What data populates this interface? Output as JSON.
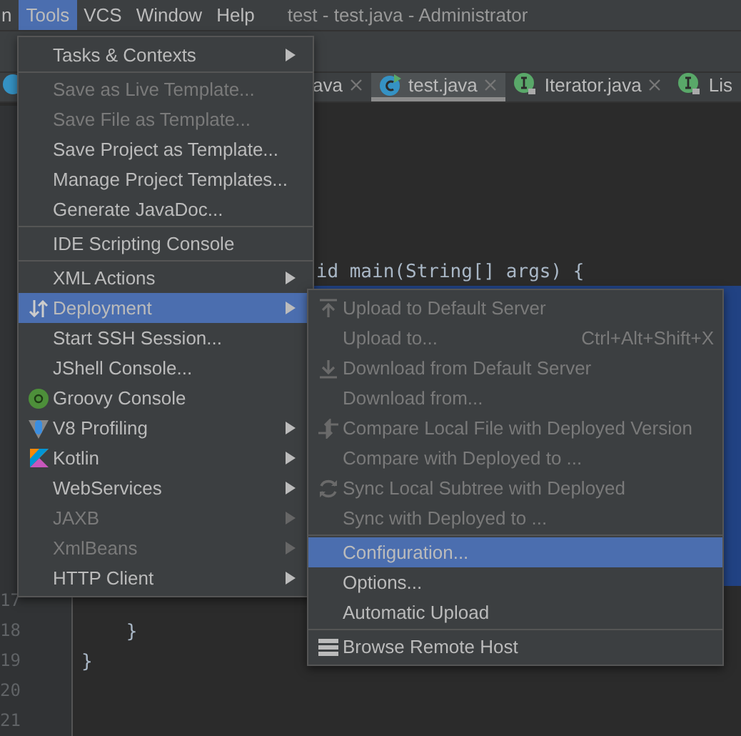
{
  "menubar": [
    {
      "label": "n",
      "selected": false
    },
    {
      "label": "Tools",
      "selected": true
    },
    {
      "label": "VCS",
      "selected": false
    },
    {
      "label": "Window",
      "selected": false
    },
    {
      "label": "Help",
      "selected": false
    }
  ],
  "window": {
    "title": "test - test.java - Administrator"
  },
  "tabs": [
    {
      "label": "ava",
      "selected": false
    },
    {
      "label": "test.java",
      "selected": true
    },
    {
      "label": "Iterator.java",
      "selected": false
    },
    {
      "label": "Lis",
      "selected": false
    }
  ],
  "editor": {
    "lines": [
      {
        "selected": false
      },
      {
        "selected": false
      },
      {
        "selected": false
      },
      {
        "selected": false
      },
      {
        "selected": false
      },
      {
        "selected": false,
        "text": "                     id main(String[] args) {"
      },
      {
        "selected": true
      },
      {
        "selected": true
      },
      {
        "selected": true
      },
      {
        "selected": true
      },
      {
        "selected": true
      },
      {
        "selected": true
      },
      {
        "selected": true
      },
      {
        "selected": true
      },
      {
        "selected": true
      },
      {
        "selected": true
      },
      {
        "number": "17",
        "selected": false
      },
      {
        "number": "18",
        "selected": false,
        "text": "    }"
      },
      {
        "number": "19",
        "selected": false,
        "text": "}"
      },
      {
        "number": "20",
        "selected": false
      },
      {
        "number": "21",
        "selected": false
      }
    ]
  },
  "tools_menu": [
    {
      "kind": "item",
      "label": "Tasks & Contexts",
      "disabled": false,
      "submenu": true,
      "selected": false
    },
    {
      "kind": "separator"
    },
    {
      "kind": "item",
      "label": "Save as Live Template...",
      "disabled": true,
      "submenu": false,
      "selected": false
    },
    {
      "kind": "item",
      "label": "Save File as Template...",
      "disabled": true,
      "submenu": false,
      "selected": false
    },
    {
      "kind": "item",
      "label": "Save Project as Template...",
      "disabled": false,
      "submenu": false,
      "selected": false
    },
    {
      "kind": "item",
      "label": "Manage Project Templates...",
      "disabled": false,
      "submenu": false,
      "selected": false
    },
    {
      "kind": "item",
      "label": "Generate JavaDoc...",
      "disabled": false,
      "submenu": false,
      "selected": false
    },
    {
      "kind": "separator"
    },
    {
      "kind": "item",
      "label": "IDE Scripting Console",
      "disabled": false,
      "submenu": false,
      "selected": false
    },
    {
      "kind": "separator"
    },
    {
      "kind": "item",
      "label": "XML Actions",
      "disabled": false,
      "submenu": true,
      "selected": false
    },
    {
      "kind": "item",
      "label": "Deployment",
      "disabled": false,
      "submenu": true,
      "selected": true
    },
    {
      "kind": "item",
      "label": "Start SSH Session...",
      "disabled": false,
      "submenu": false,
      "selected": false
    },
    {
      "kind": "item",
      "label": "JShell Console...",
      "disabled": false,
      "submenu": false,
      "selected": false
    },
    {
      "kind": "item",
      "label": "Groovy Console",
      "disabled": false,
      "submenu": false,
      "selected": false
    },
    {
      "kind": "item",
      "label": "V8 Profiling",
      "disabled": false,
      "submenu": true,
      "selected": false
    },
    {
      "kind": "item",
      "label": "Kotlin",
      "disabled": false,
      "submenu": true,
      "selected": false
    },
    {
      "kind": "item",
      "label": "WebServices",
      "disabled": false,
      "submenu": true,
      "selected": false
    },
    {
      "kind": "item",
      "label": "JAXB",
      "disabled": true,
      "submenu": true,
      "selected": false
    },
    {
      "kind": "item",
      "label": "XmlBeans",
      "disabled": true,
      "submenu": true,
      "selected": false
    },
    {
      "kind": "item",
      "label": "HTTP Client",
      "disabled": false,
      "submenu": true,
      "selected": false
    }
  ],
  "deployment_menu": [
    {
      "kind": "item",
      "label": "Upload to Default Server",
      "disabled": true,
      "selected": false
    },
    {
      "kind": "item",
      "label": "Upload to...",
      "shortcut": "Ctrl+Alt+Shift+X",
      "disabled": true,
      "selected": false
    },
    {
      "kind": "item",
      "label": "Download from Default Server",
      "disabled": true,
      "selected": false
    },
    {
      "kind": "item",
      "label": "Download from...",
      "disabled": true,
      "selected": false
    },
    {
      "kind": "item",
      "label": "Compare Local File with Deployed Version",
      "disabled": true,
      "selected": false
    },
    {
      "kind": "item",
      "label": "Compare with Deployed to ...",
      "disabled": true,
      "selected": false
    },
    {
      "kind": "item",
      "label": "Sync Local Subtree with Deployed",
      "disabled": true,
      "selected": false
    },
    {
      "kind": "item",
      "label": "Sync with Deployed to ...",
      "disabled": true,
      "selected": false
    },
    {
      "kind": "separator"
    },
    {
      "kind": "item",
      "label": "Configuration...",
      "disabled": false,
      "selected": true
    },
    {
      "kind": "item",
      "label": "Options...",
      "disabled": false,
      "selected": false
    },
    {
      "kind": "item",
      "label": "Automatic Upload",
      "disabled": false,
      "selected": false
    },
    {
      "kind": "separator"
    },
    {
      "kind": "item",
      "label": "Browse Remote Host",
      "disabled": false,
      "selected": false
    }
  ]
}
